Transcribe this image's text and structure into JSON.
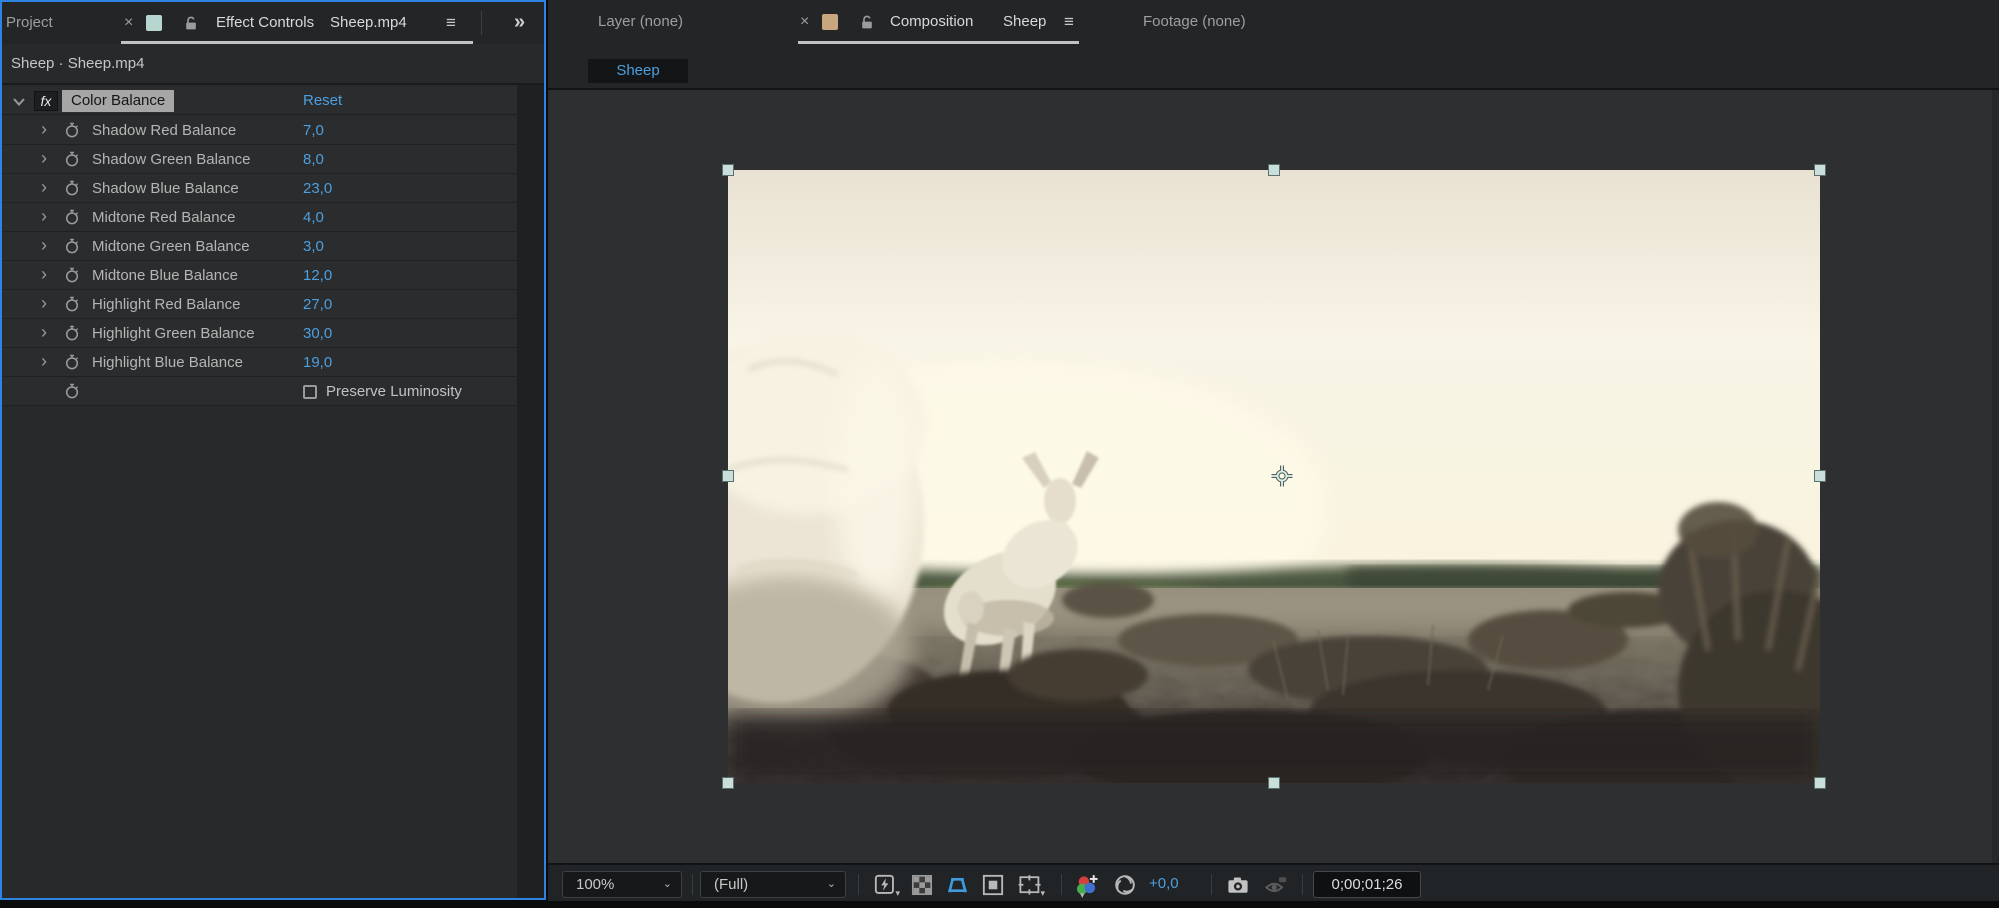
{
  "colors": {
    "accent_blue": "#4d9fdf",
    "focus_border": "#2f84e2",
    "mask_tool_blue": "#3f9bdc",
    "project_tab_square": "#b7d6cf",
    "composition_tab_square": "#c7a87e"
  },
  "icons": {
    "close": "×",
    "menu": "≡",
    "overflow": "»",
    "expander": "›",
    "dropdown": "⌄",
    "dropdown_small": "▾"
  },
  "left_panel": {
    "tabs": {
      "project": "Project",
      "effect_controls": "Effect Controls",
      "effect_controls_target": "Sheep.mp4"
    },
    "breadcrumb": "Sheep · Sheep.mp4",
    "effect": {
      "name": "Color Balance",
      "reset": "Reset",
      "params": [
        {
          "label": "Shadow Red Balance",
          "value": "7,0"
        },
        {
          "label": "Shadow Green Balance",
          "value": "8,0"
        },
        {
          "label": "Shadow Blue Balance",
          "value": "23,0"
        },
        {
          "label": "Midtone Red Balance",
          "value": "4,0"
        },
        {
          "label": "Midtone Green Balance",
          "value": "3,0"
        },
        {
          "label": "Midtone Blue Balance",
          "value": "12,0"
        },
        {
          "label": "Highlight Red Balance",
          "value": "27,0"
        },
        {
          "label": "Highlight Green Balance",
          "value": "30,0"
        },
        {
          "label": "Highlight Blue Balance",
          "value": "19,0"
        }
      ],
      "preserve_luminosity": {
        "label": "Preserve Luminosity",
        "checked": false
      }
    }
  },
  "viewer_panel": {
    "tabs": {
      "layer": "Layer (none)",
      "composition": "Composition",
      "composition_target": "Sheep",
      "footage": "Footage (none)"
    },
    "viewer_tab": "Sheep",
    "toolbar": {
      "zoom": "100%",
      "resolution": "(Full)",
      "exposure": "+0,0",
      "timecode": "0;00;01;26"
    }
  }
}
